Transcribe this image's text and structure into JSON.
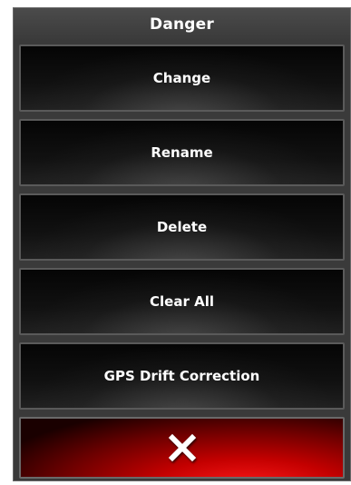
{
  "dialog": {
    "title": "Danger"
  },
  "menu": {
    "items": [
      {
        "label": "Change"
      },
      {
        "label": "Rename"
      },
      {
        "label": "Delete"
      },
      {
        "label": "Clear All"
      },
      {
        "label": "GPS Drift Correction"
      }
    ]
  },
  "close_button": {
    "icon": "close-x-icon",
    "icon_color": "#ffffff",
    "background_accent": "#d40000"
  },
  "colors": {
    "panel_background": "#3a3a3a",
    "button_background": "#0a0a0a",
    "text": "#ffffff"
  }
}
